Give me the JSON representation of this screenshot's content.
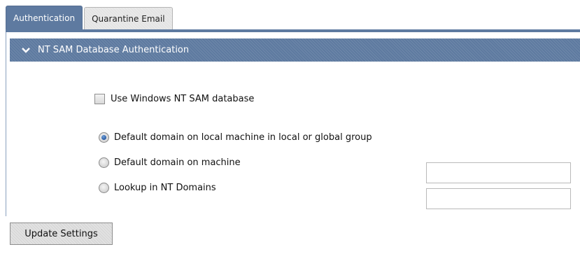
{
  "tabs": [
    {
      "label": "Authentication",
      "active": true
    },
    {
      "label": "Quarantine Email",
      "active": false
    }
  ],
  "section": {
    "title": "NT SAM Database Authentication",
    "icon": "chevron-down-icon"
  },
  "options": {
    "use_nt_sam_label": "Use Windows NT SAM database",
    "use_nt_sam_checked": false,
    "radios": [
      {
        "label": "Default domain on local machine in local or global group",
        "checked": true
      },
      {
        "label": "Default domain on machine",
        "checked": false
      },
      {
        "label": "Lookup in NT Domains",
        "checked": false
      }
    ]
  },
  "fields": {
    "machine_value": "",
    "nt_domains_value": ""
  },
  "actions": {
    "update_label": "Update Settings"
  },
  "colors": {
    "header": "#5e7aa0",
    "radio_selected": "#1e4f9a",
    "button": "#d9d9d9"
  }
}
